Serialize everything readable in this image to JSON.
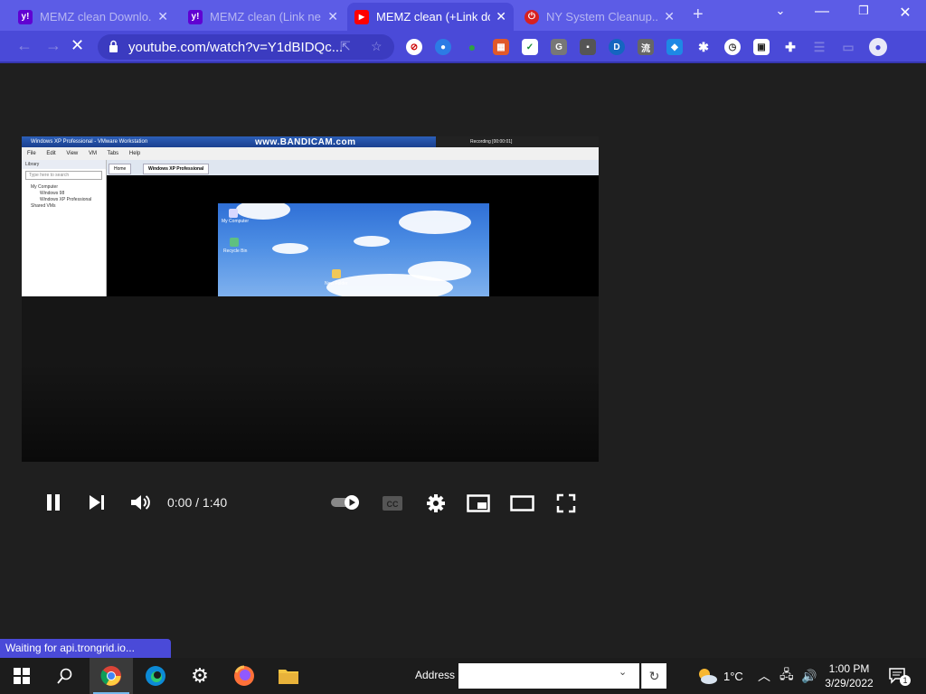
{
  "browser": {
    "tabs": [
      {
        "title": "MEMZ clean Downlo...",
        "favicon": "yahoo-icon",
        "fav_color": "#6001d2",
        "fav_text": "y!"
      },
      {
        "title": "MEMZ clean (Link ne...",
        "favicon": "yahoo-icon",
        "fav_color": "#6001d2",
        "fav_text": "y!"
      },
      {
        "title": "MEMZ clean (+Link do",
        "favicon": "youtube-icon",
        "fav_color": "#ff0000",
        "fav_text": "▶",
        "active": true
      },
      {
        "title": "NY System Cleanup...",
        "favicon": "power-icon",
        "fav_color": "#d82020",
        "fav_text": "⏻"
      }
    ],
    "new_tab": "+",
    "url": "youtube.com/watch?v=Y1dBIDQc...",
    "accent_color": "#4a4ad8"
  },
  "video": {
    "watermark": "www.BANDICAM.com",
    "recording_text": "Recording [00:00:01]",
    "vm_window_title": "Windows XP Professional - VMware Workstation",
    "vm_menu": [
      "File",
      "Edit",
      "View",
      "VM",
      "Tabs",
      "Help"
    ],
    "library_title": "Library",
    "library_search": "Type here to search",
    "library_items": [
      "My Computer",
      "Windows 98",
      "Windows XP Professional",
      "Shared VMs"
    ],
    "vm_tabs": [
      "Home",
      "Windows XP Professional"
    ],
    "desktop_icons": [
      "My Computer",
      "Recycle Bin",
      "New Folder"
    ],
    "time": "0:00 / 1:40"
  },
  "status_text": "Waiting for api.trongrid.io...",
  "taskbar": {
    "address_label": "Address",
    "weather": "1°C",
    "time": "1:00 PM",
    "date": "3/29/2022",
    "notification_count": "1"
  }
}
